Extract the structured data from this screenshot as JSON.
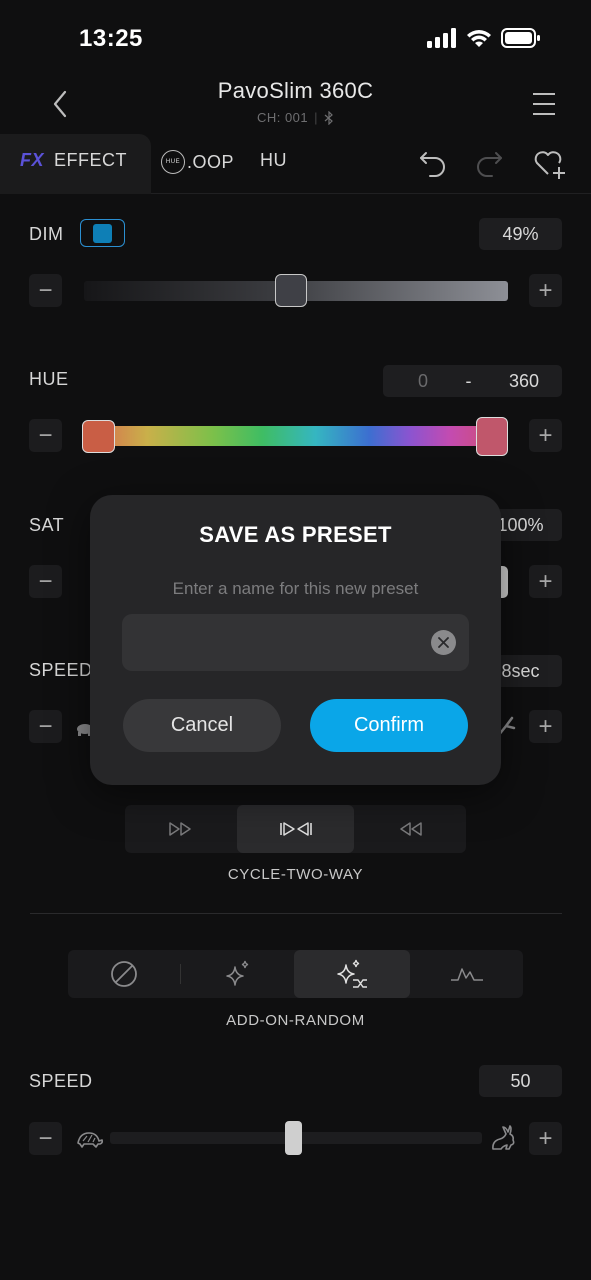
{
  "status_bar": {
    "time": "13:25"
  },
  "header": {
    "title": "PavoSlim 360C",
    "channel": "CH: 001"
  },
  "tabs": [
    {
      "icon_text": "FX",
      "label": "EFFECT"
    },
    {
      "icon_text": "HUE",
      "label": ".OOP"
    },
    {
      "label": "HU"
    }
  ],
  "dim": {
    "label": "DIM",
    "value": "49%",
    "level": 0.49,
    "enabled": true
  },
  "hue": {
    "label": "HUE",
    "min": "0",
    "separator": "-",
    "max": "360"
  },
  "sat": {
    "label": "SAT",
    "value": "100%"
  },
  "speed1": {
    "label": "SPEED",
    "value": "8sec"
  },
  "direction": {
    "options": [
      "forward",
      "cycle-two-way",
      "reverse"
    ],
    "selected": "cycle-two-way",
    "caption": "CYCLE-TWO-WAY"
  },
  "random": {
    "options": [
      "none",
      "sparkle",
      "add-on-random",
      "pulse"
    ],
    "selected": "add-on-random",
    "caption": "ADD-ON-RANDOM"
  },
  "speed2": {
    "label": "SPEED",
    "value": "50"
  },
  "modal": {
    "title": "SAVE AS PRESET",
    "subtitle": "Enter a name for this new preset",
    "input_value": "",
    "cancel_label": "Cancel",
    "confirm_label": "Confirm"
  },
  "colors": {
    "accent": "#0aa6e8",
    "background": "#0f0f10",
    "modal": "#262628",
    "fx_icon": "#5b52d8"
  }
}
